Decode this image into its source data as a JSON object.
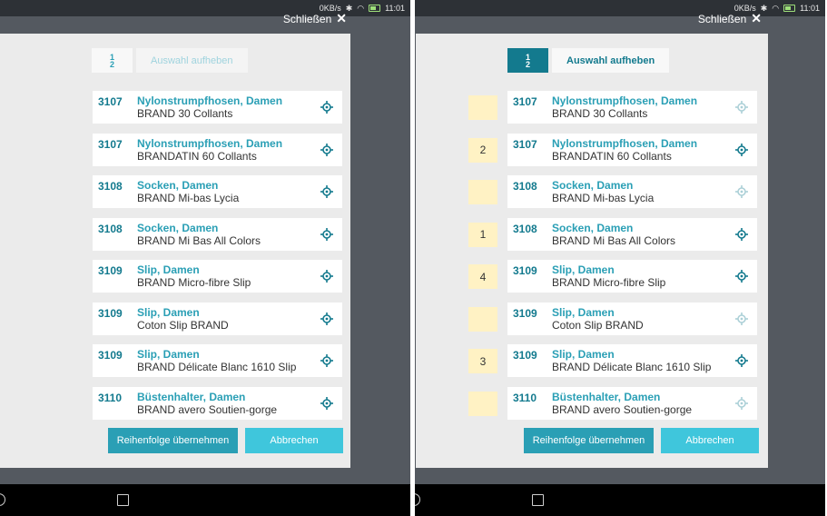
{
  "status": {
    "speed": "0KB/s",
    "time": "11:01"
  },
  "close_label": "Schließen",
  "close_glyph": "✕",
  "sort_icon": {
    "name": "sort-numbered-icon",
    "top": "1",
    "bottom": "2"
  },
  "clear_selection_label": "Auswahl aufheben",
  "apply_order_label": "Reihenfolge übernehmen",
  "cancel_label": "Abbrechen",
  "colors": {
    "accent": "#2a9fb5",
    "accent_dark": "#137a8e",
    "accent_light": "#3fc6dc",
    "badge": "#fff2c4",
    "overlay": "#545960"
  },
  "items": [
    {
      "code": "3107",
      "title": "Nylonstrumpfhosen, Damen",
      "subtitle": "BRAND 30 Collants"
    },
    {
      "code": "3107",
      "title": "Nylonstrumpfhosen, Damen",
      "subtitle": "BRANDATIN 60 Collants"
    },
    {
      "code": "3108",
      "title": "Socken, Damen",
      "subtitle": "BRAND Mi-bas Lycia"
    },
    {
      "code": "3108",
      "title": "Socken, Damen",
      "subtitle": "BRAND Mi Bas All Colors"
    },
    {
      "code": "3109",
      "title": "Slip, Damen",
      "subtitle": "BRAND Micro-fibre Slip"
    },
    {
      "code": "3109",
      "title": "Slip, Damen",
      "subtitle": "Coton Slip BRAND"
    },
    {
      "code": "3109",
      "title": "Slip, Damen",
      "subtitle": "BRAND Délicate Blanc 1610 Slip"
    },
    {
      "code": "3110",
      "title": "Büstenhalter, Damen",
      "subtitle": "BRAND avero Soutien-gorge"
    }
  ],
  "right_order_badges": [
    "",
    "2",
    "",
    "1",
    "4",
    "",
    "3",
    ""
  ]
}
